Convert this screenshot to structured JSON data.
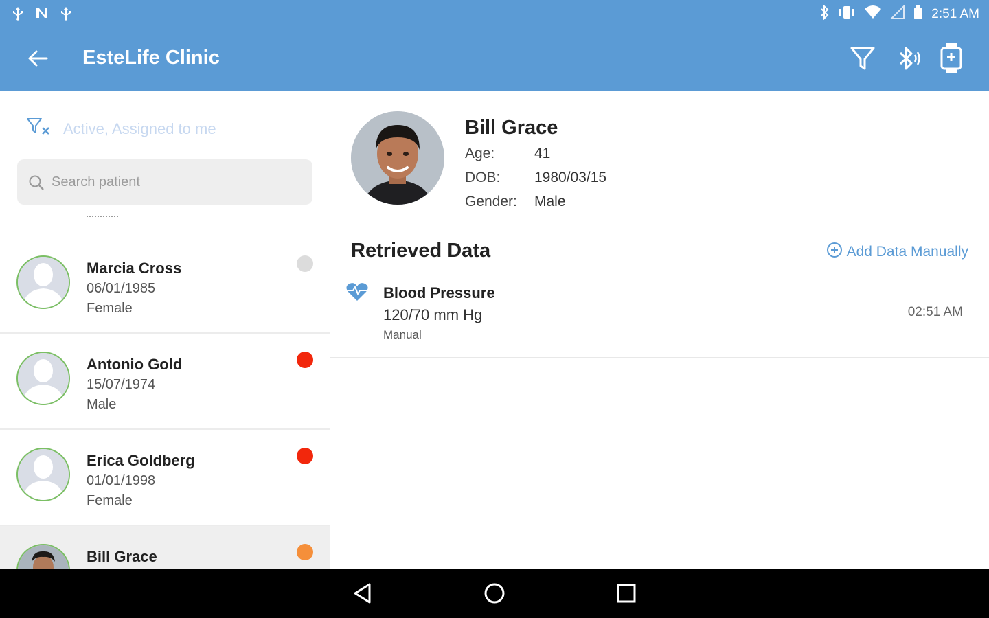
{
  "status_bar": {
    "time": "2:51 AM",
    "left_icons": [
      "usb-icon",
      "nfc-icon",
      "usb-icon"
    ],
    "right_icons": [
      "bluetooth-icon",
      "vibrate-icon",
      "wifi-icon",
      "signal-icon",
      "battery-icon"
    ]
  },
  "app_bar": {
    "title": "EsteLife Clinic",
    "actions": [
      "filter-icon",
      "bluetooth-device-icon",
      "smartwatch-icon"
    ]
  },
  "filter": {
    "text": "Active, Assigned to me"
  },
  "search": {
    "placeholder": "Search patient"
  },
  "patients": [
    {
      "name": "Marcia Cross",
      "dob": "06/01/1985",
      "gender": "Female",
      "status_color": "#dcdcdc"
    },
    {
      "name": "Antonio Gold",
      "dob": "15/07/1974",
      "gender": "Male",
      "status_color": "#f2270c"
    },
    {
      "name": "Erica Goldberg",
      "dob": "01/01/1998",
      "gender": "Female",
      "status_color": "#f2270c"
    },
    {
      "name": "Bill Grace",
      "status_color": "#f58f3a"
    }
  ],
  "selected_patient": {
    "name": "Bill Grace",
    "age_label": "Age:",
    "age": "41",
    "dob_label": "DOB:",
    "dob": "1980/03/15",
    "gender_label": "Gender:",
    "gender": "Male"
  },
  "retrieved": {
    "title": "Retrieved Data",
    "add_manual": "Add Data Manually",
    "entries": [
      {
        "title": "Blood Pressure",
        "value": "120/70 mm Hg",
        "source": "Manual",
        "time": "02:51 AM"
      }
    ]
  },
  "colors": {
    "primary": "#5b9bd5",
    "avatar_ring": "#7bbf64",
    "link": "#5b9bd5"
  }
}
